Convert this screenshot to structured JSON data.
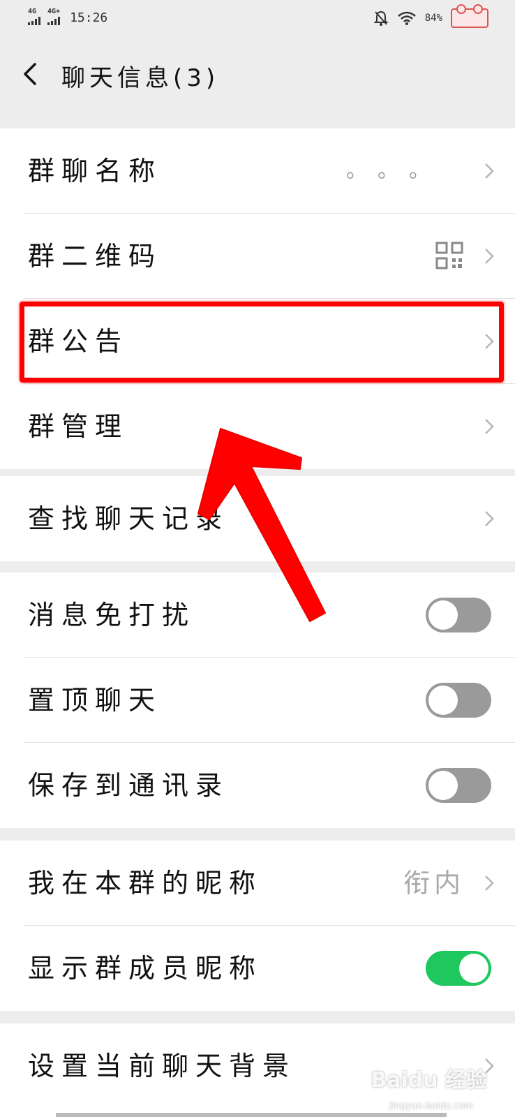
{
  "status_bar": {
    "signal1": "4G",
    "signal2": "4G+",
    "time": "15:26",
    "battery_percent": "84%"
  },
  "header": {
    "title": "聊天信息(3)"
  },
  "section1": {
    "group_name_label": "群聊名称",
    "group_name_value": "。。。",
    "group_qr_label": "群二维码",
    "group_notice_label": "群公告",
    "group_manage_label": "群管理"
  },
  "section2": {
    "search_history_label": "查找聊天记录"
  },
  "section3": {
    "mute_label": "消息免打扰",
    "mute_on": false,
    "pin_label": "置顶聊天",
    "pin_on": false,
    "save_contacts_label": "保存到通讯录",
    "save_contacts_on": false
  },
  "section4": {
    "my_nickname_label": "我在本群的昵称",
    "my_nickname_value": "衔内",
    "show_nicknames_label": "显示群成员昵称",
    "show_nicknames_on": true
  },
  "section5": {
    "background_label": "设置当前聊天背景"
  },
  "watermark": {
    "text": "Baidu 经验",
    "sub": "jingyan.baidu.com"
  },
  "colors": {
    "highlight": "#ff0000",
    "toggle_on": "#1ec85e",
    "toggle_off": "#9a9a9a"
  }
}
